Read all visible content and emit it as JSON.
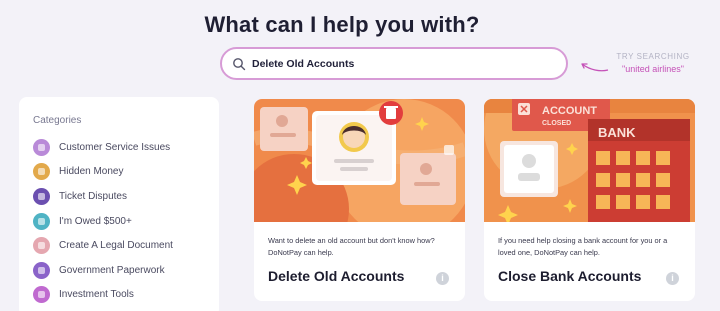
{
  "heading": "What can I help you with?",
  "search": {
    "value": "Delete Old Accounts"
  },
  "try_searching": {
    "label": "TRY SEARCHING",
    "example": "\"united airlines\""
  },
  "sidebar": {
    "title": "Categories",
    "items": [
      {
        "label": "Customer Service Issues",
        "color": "#b98ad8"
      },
      {
        "label": "Hidden Money",
        "color": "#e2a94b"
      },
      {
        "label": "Ticket Disputes",
        "color": "#6b4fb0"
      },
      {
        "label": "I'm Owed $500+",
        "color": "#4fb3c4"
      },
      {
        "label": "Create A Legal Document",
        "color": "#e5a7b0"
      },
      {
        "label": "Government Paperwork",
        "color": "#8a63c9"
      },
      {
        "label": "Investment Tools",
        "color": "#c06ad0"
      }
    ]
  },
  "cards": [
    {
      "description": "Want to delete an old account but don't know how? DoNotPay can help.",
      "title": "Delete Old Accounts"
    },
    {
      "description": "If you need help closing a bank account for you or a loved one, DoNotPay can help.",
      "title": "Close Bank Accounts",
      "badge": "ACCOUNT CLOSED",
      "bank_sign": "BANK"
    }
  ]
}
